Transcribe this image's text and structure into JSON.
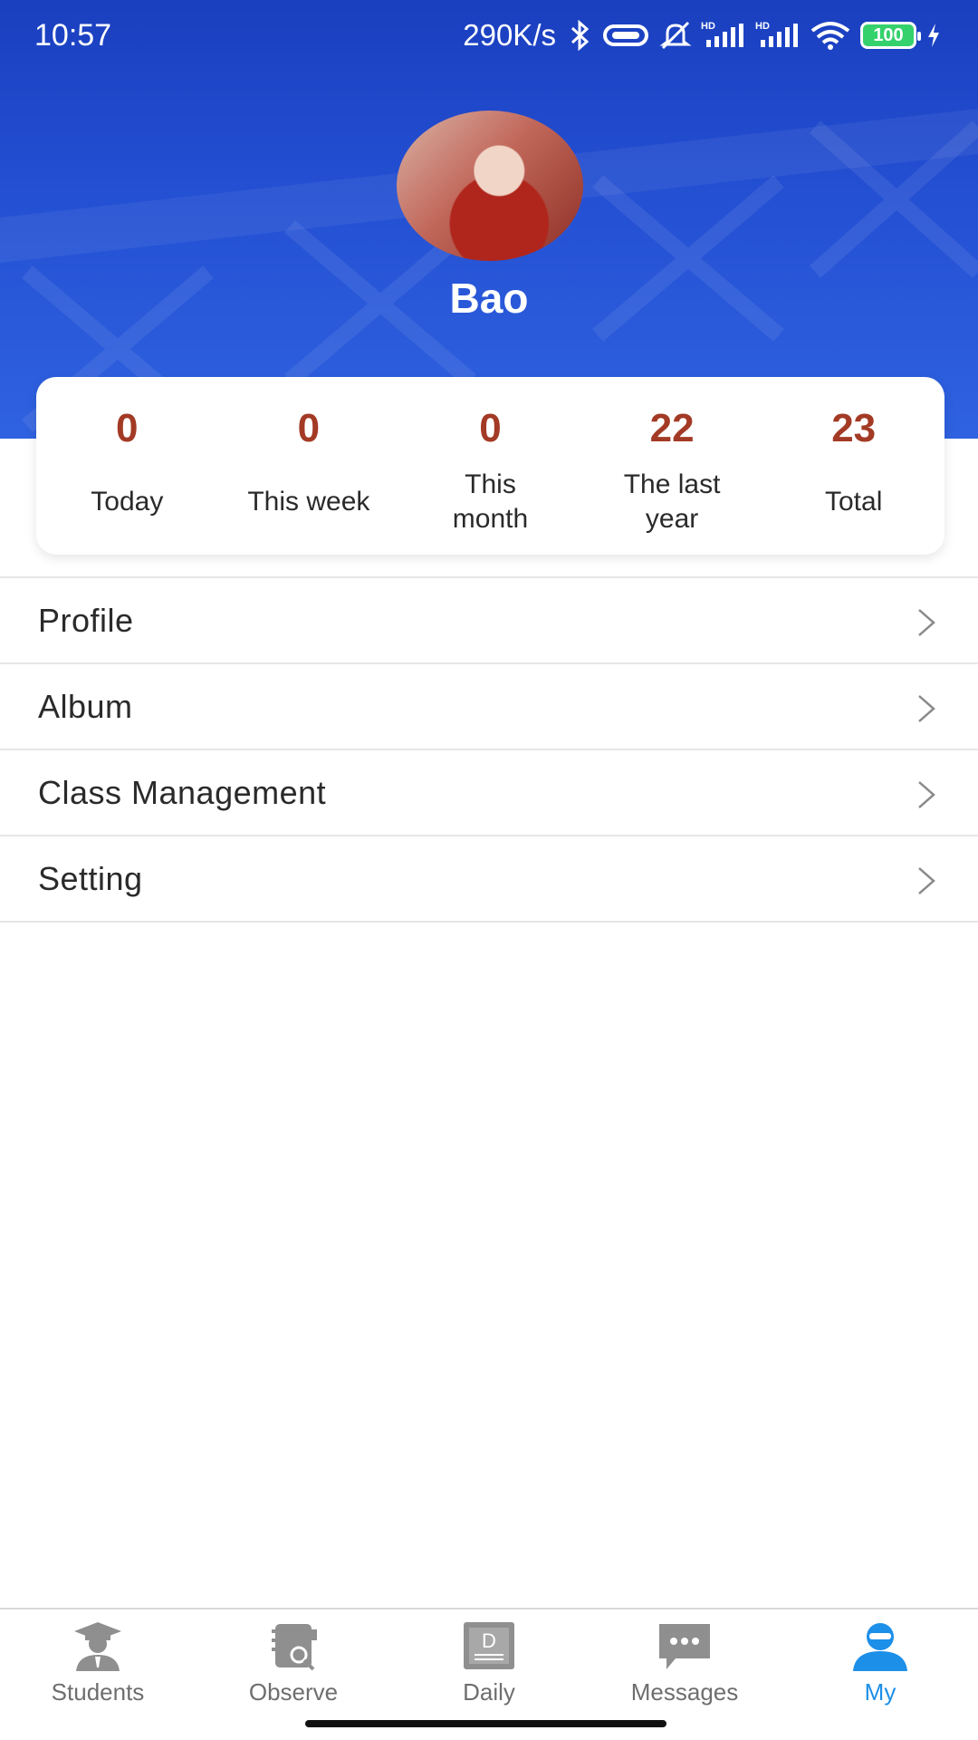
{
  "status_bar": {
    "time": "10:57",
    "network_speed": "290K/s",
    "battery_level": "100",
    "icons": [
      "bluetooth-icon",
      "vibrate-icon",
      "mute-bell-icon",
      "signal-hd-icon",
      "signal-hd-icon",
      "wifi-icon",
      "battery-icon",
      "charging-icon"
    ]
  },
  "profile": {
    "name": "Bao"
  },
  "stats": [
    {
      "value": "0",
      "label": "Today"
    },
    {
      "value": "0",
      "label": "This week"
    },
    {
      "value": "0",
      "label": "This month"
    },
    {
      "value": "22",
      "label": "The last year"
    },
    {
      "value": "23",
      "label": "Total"
    }
  ],
  "menu": [
    {
      "label": "Profile"
    },
    {
      "label": "Album"
    },
    {
      "label": "Class Management"
    },
    {
      "label": "Setting"
    }
  ],
  "bottom_nav": [
    {
      "label": "Students",
      "icon": "graduate-icon"
    },
    {
      "label": "Observe",
      "icon": "notebook-search-icon"
    },
    {
      "label": "Daily",
      "icon": "daily-d-icon"
    },
    {
      "label": "Messages",
      "icon": "chat-bubble-icon"
    },
    {
      "label": "My",
      "icon": "person-icon",
      "active": true
    }
  ],
  "colors": {
    "header_blue": "#1a3fbf",
    "stat_value": "#a33a25",
    "active_tab": "#1c8fe8",
    "inactive_tab": "#6e6e6e"
  }
}
